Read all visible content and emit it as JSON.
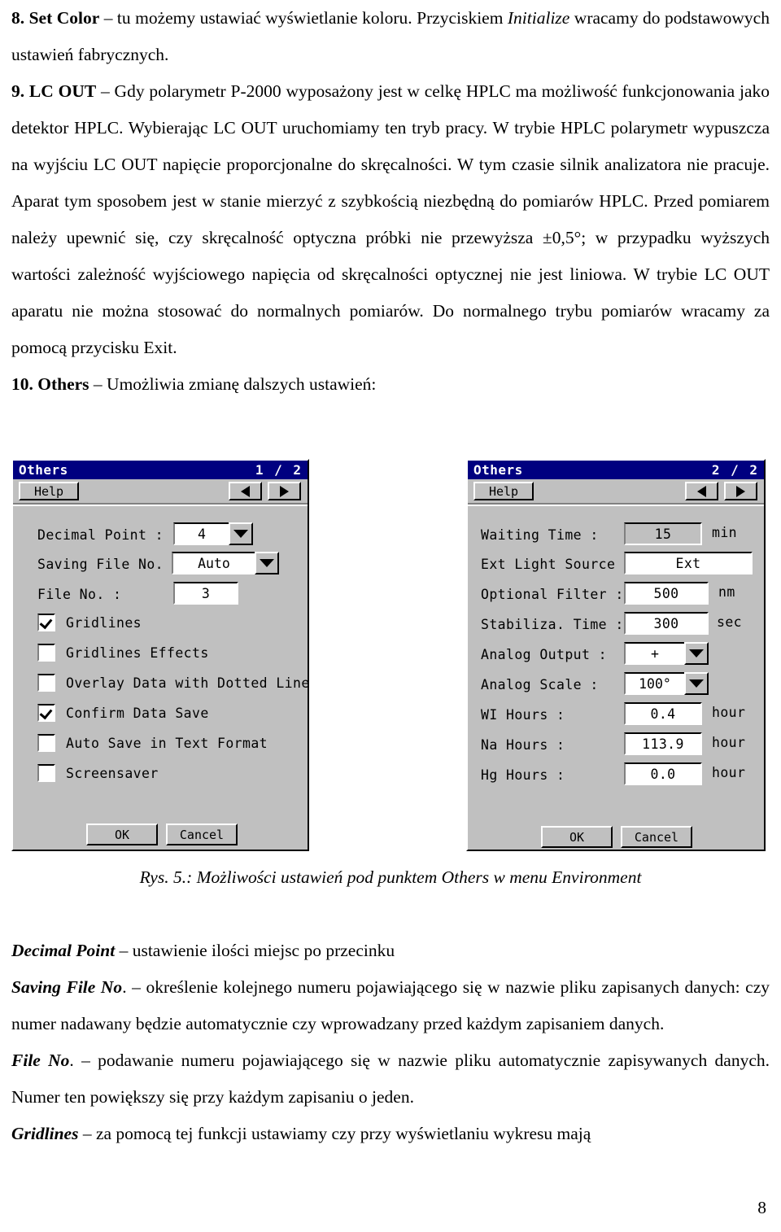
{
  "document": {
    "paragraphs": [
      {
        "id": "p8",
        "runs": [
          {
            "text": "8. Set Color",
            "style": "b"
          },
          {
            "text": " – tu możemy ustawiać wyświetlanie koloru. Przyciskiem ",
            "style": ""
          },
          {
            "text": "Initialize",
            "style": "i"
          },
          {
            "text": " wracamy do podstawowych ustawień fabrycznych.",
            "style": ""
          }
        ]
      },
      {
        "id": "p9",
        "runs": [
          {
            "text": "9. LC OUT",
            "style": "b"
          },
          {
            "text": " – Gdy polarymetr P-2000 wyposażony jest w celkę HPLC ma możliwość funkcjonowania jako detektor HPLC. Wybierając LC OUT uruchomiamy ten tryb pracy. W trybie HPLC polarymetr wypuszcza na wyjściu LC OUT napięcie proporcjonalne do skręcalności. W tym czasie silnik analizatora nie pracuje. Aparat tym sposobem jest w stanie mierzyć z szybkością niezbędną do pomiarów HPLC. Przed pomiarem należy upewnić się, czy skręcalność optyczna próbki nie przewyższa ±0,5°; w przypadku wyższych wartości zależność wyjściowego napięcia od skręcalności optycznej nie jest liniowa. W trybie LC OUT aparatu nie można stosować do normalnych pomiarów. Do normalnego trybu pomiarów wracamy za pomocą przycisku Exit.",
            "style": ""
          }
        ]
      },
      {
        "id": "p10",
        "runs": [
          {
            "text": "10. Others",
            "style": "b"
          },
          {
            "text": " – Umożliwia zmianę dalszych ustawień:",
            "style": ""
          }
        ]
      }
    ],
    "caption": "Rys. 5.: Możliwości ustawień pod punktem Others w menu Environment",
    "glossary": [
      {
        "id": "g1",
        "runs": [
          {
            "text": "Decimal Point",
            "style": "bi"
          },
          {
            "text": " –  ustawienie ilości miejsc po przecinku",
            "style": ""
          }
        ]
      },
      {
        "id": "g2",
        "runs": [
          {
            "text": "Saving File No",
            "style": "bi"
          },
          {
            "text": ". –  określenie kolejnego numeru pojawiającego się w nazwie pliku zapisanych danych: czy numer nadawany będzie automatycznie czy wprowadzany przed każdym zapisaniem danych.",
            "style": ""
          }
        ]
      },
      {
        "id": "g3",
        "runs": [
          {
            "text": "File No",
            "style": "bi"
          },
          {
            "text": ". – podawanie numeru pojawiającego się w nazwie pliku automatycznie zapisywanych danych. Numer ten powiększy się przy każdym zapisaniu o jeden.",
            "style": ""
          }
        ]
      },
      {
        "id": "g4",
        "runs": [
          {
            "text": "Gridlines",
            "style": "bi"
          },
          {
            "text": " – za pomocą tej funkcji ustawiamy czy przy wyświetlaniu wykresu mają",
            "style": ""
          }
        ]
      }
    ],
    "page_number": "8"
  },
  "colors": {
    "titlebar": "#000080",
    "dialog_face": "#c0c0c0",
    "field_bg": "#ffffff",
    "shadow": "#808080"
  },
  "dialog_left": {
    "title": "Others",
    "page_indicator": "1 / 2",
    "help_label": "Help",
    "prev_icon": "triangle-left-icon",
    "next_icon": "triangle-right-icon",
    "fields": [
      {
        "label": "Decimal Point :",
        "value": "4",
        "type": "combo"
      },
      {
        "label": "Saving File No. :",
        "value": "Auto",
        "type": "combo"
      },
      {
        "label": "File No. :",
        "value": "3",
        "type": "text"
      }
    ],
    "checkboxes": [
      {
        "label": "Gridlines",
        "checked": true
      },
      {
        "label": "Gridlines Effects",
        "checked": false
      },
      {
        "label": "Overlay Data with Dotted Line",
        "checked": false
      },
      {
        "label": "Confirm Data Save",
        "checked": true
      },
      {
        "label": "Auto Save in Text Format",
        "checked": false
      },
      {
        "label": "Screensaver",
        "checked": false
      }
    ],
    "ok_label": "OK",
    "cancel_label": "Cancel"
  },
  "dialog_right": {
    "title": "Others",
    "page_indicator": "2 / 2",
    "help_label": "Help",
    "prev_icon": "triangle-left-icon",
    "next_icon": "triangle-right-icon",
    "fields": [
      {
        "label": "Waiting Time :",
        "value": "15",
        "unit": "min",
        "type": "text-disabled"
      },
      {
        "label": "Ext Light Source :",
        "value": "Ext",
        "unit": "",
        "type": "text"
      },
      {
        "label": "Optional Filter :",
        "value": "500",
        "unit": "nm",
        "type": "text"
      },
      {
        "label": "Stabiliza. Time :",
        "value": "300",
        "unit": "sec",
        "type": "text"
      },
      {
        "label": "Analog Output :",
        "value": "+",
        "unit": "",
        "type": "combo"
      },
      {
        "label": "Analog Scale :",
        "value": "100°",
        "unit": "",
        "type": "combo"
      },
      {
        "label": "WI Hours :",
        "value": "0.4",
        "unit": "hour",
        "type": "text"
      },
      {
        "label": "Na Hours :",
        "value": "113.9",
        "unit": "hour",
        "type": "text"
      },
      {
        "label": "Hg Hours :",
        "value": "0.0",
        "unit": "hour",
        "type": "text"
      }
    ],
    "ok_label": "OK",
    "cancel_label": "Cancel"
  }
}
